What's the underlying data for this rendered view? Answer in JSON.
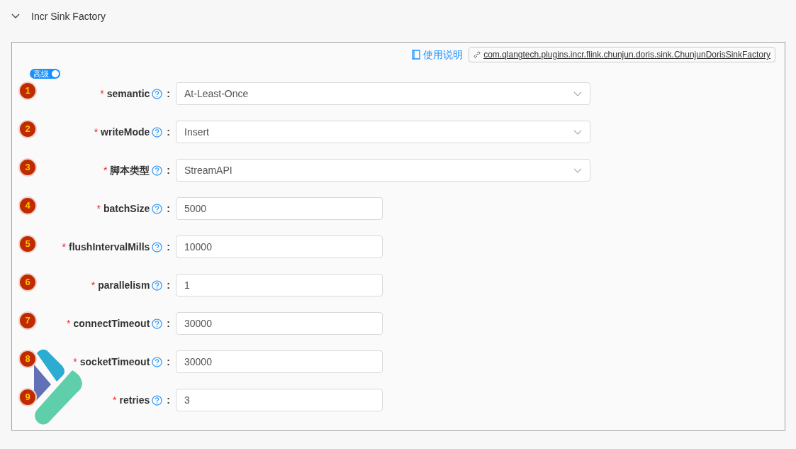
{
  "section": {
    "title": "Incr Sink Factory",
    "expanded": true
  },
  "doc_link": "使用说明",
  "class_name": "com.qlangtech.plugins.incr.flink.chunjun.doris.sink.ChunjunDorisSinkFactory",
  "advanced_toggle": {
    "label": "高级",
    "on": true
  },
  "fields": [
    {
      "number": "1",
      "required_mark": "*",
      "label": "semantic",
      "colon": ":",
      "kind": "select",
      "value": "At-Least-Once"
    },
    {
      "number": "2",
      "required_mark": "*",
      "label": "writeMode",
      "colon": ":",
      "kind": "select",
      "value": "Insert"
    },
    {
      "number": "3",
      "required_mark": "*",
      "label": "脚本类型",
      "colon": ":",
      "kind": "select",
      "value": "StreamAPI"
    },
    {
      "number": "4",
      "required_mark": "*",
      "label": "batchSize",
      "colon": ":",
      "kind": "input",
      "value": "5000"
    },
    {
      "number": "5",
      "required_mark": "*",
      "label": "flushIntervalMills",
      "colon": ":",
      "kind": "input",
      "value": "10000"
    },
    {
      "number": "6",
      "required_mark": "*",
      "label": "parallelism",
      "colon": ":",
      "kind": "input",
      "value": "1"
    },
    {
      "number": "7",
      "required_mark": "*",
      "label": "connectTimeout",
      "colon": ":",
      "kind": "input",
      "value": "30000"
    },
    {
      "number": "8",
      "required_mark": "*",
      "label": "socketTimeout",
      "colon": ":",
      "kind": "input",
      "value": "30000"
    },
    {
      "number": "9",
      "required_mark": "*",
      "label": "retries",
      "colon": ":",
      "kind": "input",
      "value": "3"
    }
  ]
}
